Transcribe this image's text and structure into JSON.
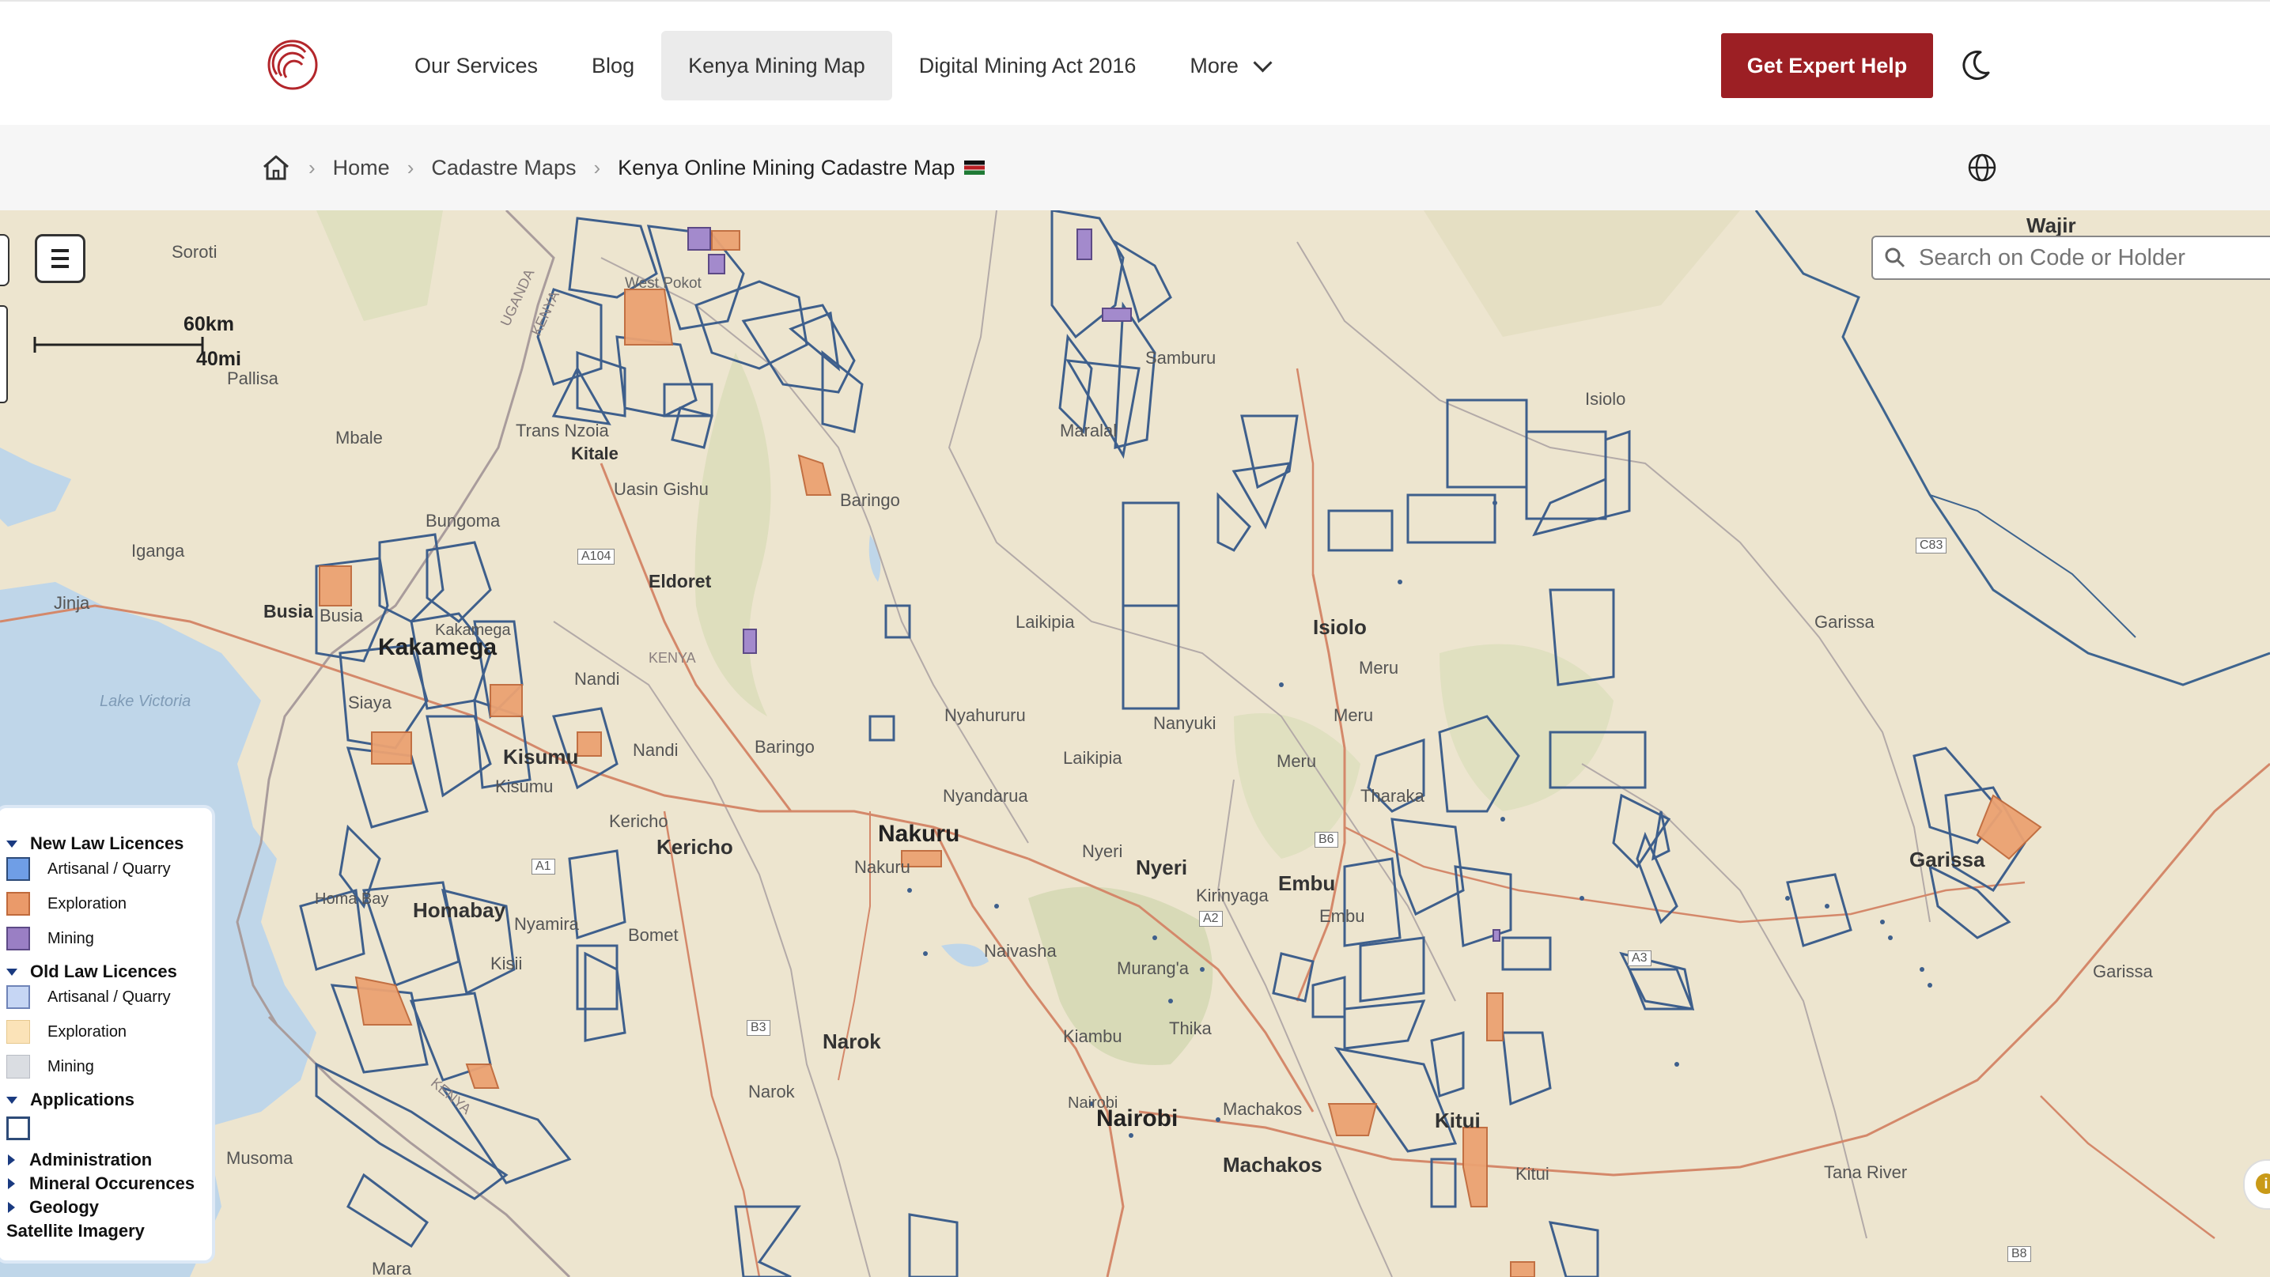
{
  "header": {
    "nav": [
      {
        "label": "Our Services",
        "active": false
      },
      {
        "label": "Blog",
        "active": false
      },
      {
        "label": "Kenya Mining Map",
        "active": true
      },
      {
        "label": "Digital Mining Act 2016",
        "active": false
      },
      {
        "label": "More",
        "active": false
      }
    ],
    "cta_label": "Get Expert Help",
    "brand_color": "#9c1f24"
  },
  "breadcrumb": {
    "home": "Home",
    "section": "Cadastre Maps",
    "current": "Kenya Online Mining Cadastre Map",
    "current_flag": "🇰🇪"
  },
  "map": {
    "search_placeholder": "Search on Code or Holder",
    "scale": {
      "km": "60km",
      "mi": "40mi"
    },
    "labels": {
      "soroti": "Soroti",
      "pallisa": "Pallisa",
      "mbale": "Mbale",
      "iganga": "Iganga",
      "jinja": "Jinja",
      "busia": "Busia",
      "busia2": "Busia",
      "lake_victoria": "Lake Victoria",
      "trans_nzoia": "Trans Nzoia",
      "kitale": "Kitale",
      "uasin_gishu": "Uasin Gishu",
      "bungoma": "Bungoma",
      "eldoret": "Eldoret",
      "kakamega": "Kakamega",
      "kakamega2": "Kakamega",
      "siaya": "Siaya",
      "nandi": "Nandi",
      "nandi2": "Nandi",
      "kisumu": "Kisumu",
      "kisumu2": "Kisumu",
      "kericho": "Kericho",
      "kericho2": "Kericho",
      "homabay": "Homabay",
      "homa_bay": "Homa Bay",
      "nyamira": "Nyamira",
      "kisii": "Kisii",
      "bomet": "Bomet",
      "baringo": "Baringo",
      "baringo2": "Baringo",
      "laikipia": "Laikipia",
      "laikipia2": "Laikipia",
      "nyahururu": "Nyahururu",
      "nanyuki": "Nanyuki",
      "nyandarua": "Nyandarua",
      "nakuru": "Nakuru",
      "nakuru2": "Nakuru",
      "naivasha": "Naivasha",
      "nyeri": "Nyeri",
      "nyeri2": "Nyeri",
      "kirinyaga": "Kirinyaga",
      "muranga": "Murang'a",
      "narok": "Narok",
      "narok2": "Narok",
      "kiambu": "Kiambu",
      "thika": "Thika",
      "nairobi": "Nairobi",
      "nairobi2": "Nairobi",
      "machakos": "Machakos",
      "machakos2": "Machakos",
      "embu": "Embu",
      "embu2": "Embu",
      "meru": "Meru",
      "meru2": "Meru",
      "meru3": "Meru",
      "tharaka": "Tharaka",
      "isiolo": "Isiolo",
      "isiolo2": "Isiolo",
      "samburu": "Samburu",
      "maralal": "Maralal",
      "kitui": "Kitui",
      "kitui2": "Kitui",
      "garissa": "Garissa",
      "garissa2": "Garissa",
      "garissa3": "Garissa",
      "tana_river": "Tana River",
      "wajir": "Wajir",
      "musoma": "Musoma",
      "mara": "Mara",
      "west_pokot": "West Pokot",
      "uganda": "UGANDA",
      "kenya": "KENYA",
      "kenya2": "KENYA",
      "kenya3": "KENYA",
      "a104": "A104",
      "a1": "A1",
      "a2": "A2",
      "a3": "A3",
      "b3": "B3",
      "b6": "B6",
      "b8": "B8",
      "c83": "C83"
    }
  },
  "legend": {
    "new_law": {
      "title": "New Law Licences",
      "items": [
        "Artisanal / Quarry",
        "Exploration",
        "Mining"
      ]
    },
    "old_law": {
      "title": "Old Law Licences",
      "items": [
        "Artisanal / Quarry",
        "Exploration",
        "Mining"
      ]
    },
    "applications": "Applications",
    "administration": "Administration",
    "mineral": "Mineral Occurences",
    "geology": "Geology",
    "satellite": "Satellite Imagery",
    "colors": {
      "new_artisanal": "#6f9ee6",
      "new_exploration": "#ea9a6a",
      "new_mining": "#9a7fc4",
      "old_artisanal": "#c6d6f4",
      "old_exploration": "#fbe3b8",
      "old_mining": "#dadde2",
      "licence_outline": "#2e4b78"
    }
  },
  "info_label": "i"
}
